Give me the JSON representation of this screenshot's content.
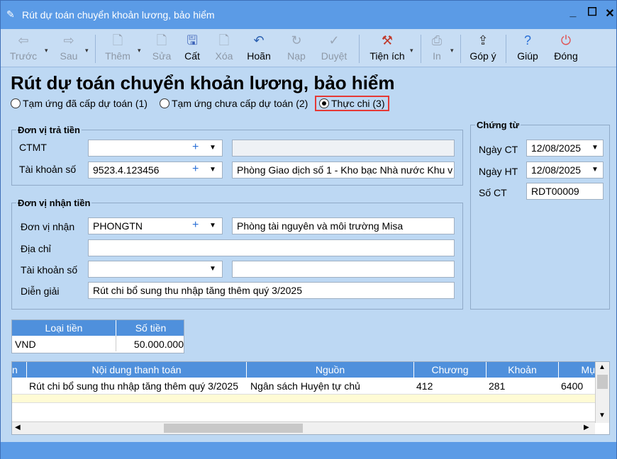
{
  "window": {
    "title": "Rút dự toán chuyển khoản lương, bảo hiểm"
  },
  "toolbar": {
    "prev": "Trước",
    "next": "Sau",
    "add": "Thêm",
    "edit": "Sửa",
    "save": "Cất",
    "delete": "Xóa",
    "undo": "Hoãn",
    "load": "Nạp",
    "approve": "Duyệt",
    "utilities": "Tiện ích",
    "print": "In",
    "feedback": "Góp ý",
    "help": "Giúp",
    "close": "Đóng"
  },
  "page": {
    "title": "Rút dự toán chuyển khoản lương, bảo hiểm",
    "radios": [
      "Tạm ứng đã cấp dự toán (1)",
      "Tạm ứng chưa cấp dự toán (2)",
      "Thực chi (3)"
    ]
  },
  "payer": {
    "legend": "Đơn vị trả tiền",
    "ctmt_label": "CTMT",
    "ctmt_value": "",
    "ctmt_desc": "",
    "account_label": "Tài khoản số",
    "account_value": "9523.4.123456",
    "account_desc": "Phòng Giao dịch số 1 - Kho bạc Nhà nước Khu v"
  },
  "payee": {
    "legend": "Đơn vị nhận tiền",
    "unit_label": "Đơn vị nhận",
    "unit_value": "PHONGTN",
    "unit_desc": "Phòng tài nguyên và môi trường Misa",
    "address_label": "Địa chỉ",
    "address_value": "",
    "account_label": "Tài khoản số",
    "account_value": "",
    "account_desc": "",
    "note_label": "Diễn giải",
    "note_value": "Rút chi bổ sung thu nhập tăng thêm quý 3/2025"
  },
  "voucher": {
    "legend": "Chứng từ",
    "ct_date_label": "Ngày CT",
    "ct_date": "12/08/2025",
    "ht_date_label": "Ngày HT",
    "ht_date": "12/08/2025",
    "no_label": "Số CT",
    "no_value": "RDT00009"
  },
  "currency_grid": {
    "headers": [
      "Loại tiền",
      "Số tiền"
    ],
    "row": [
      "VND",
      "50.000.000"
    ]
  },
  "detail_grid": {
    "headers": [
      "n",
      "Nội dung thanh toán",
      "Nguồn",
      "Chương",
      "Khoản",
      "Mụ"
    ],
    "row": [
      "",
      "Rút chi bổ sung thu nhập tăng thêm quý 3/2025",
      "Ngân sách Huyện tự chủ",
      "412",
      "281",
      "6400"
    ]
  }
}
